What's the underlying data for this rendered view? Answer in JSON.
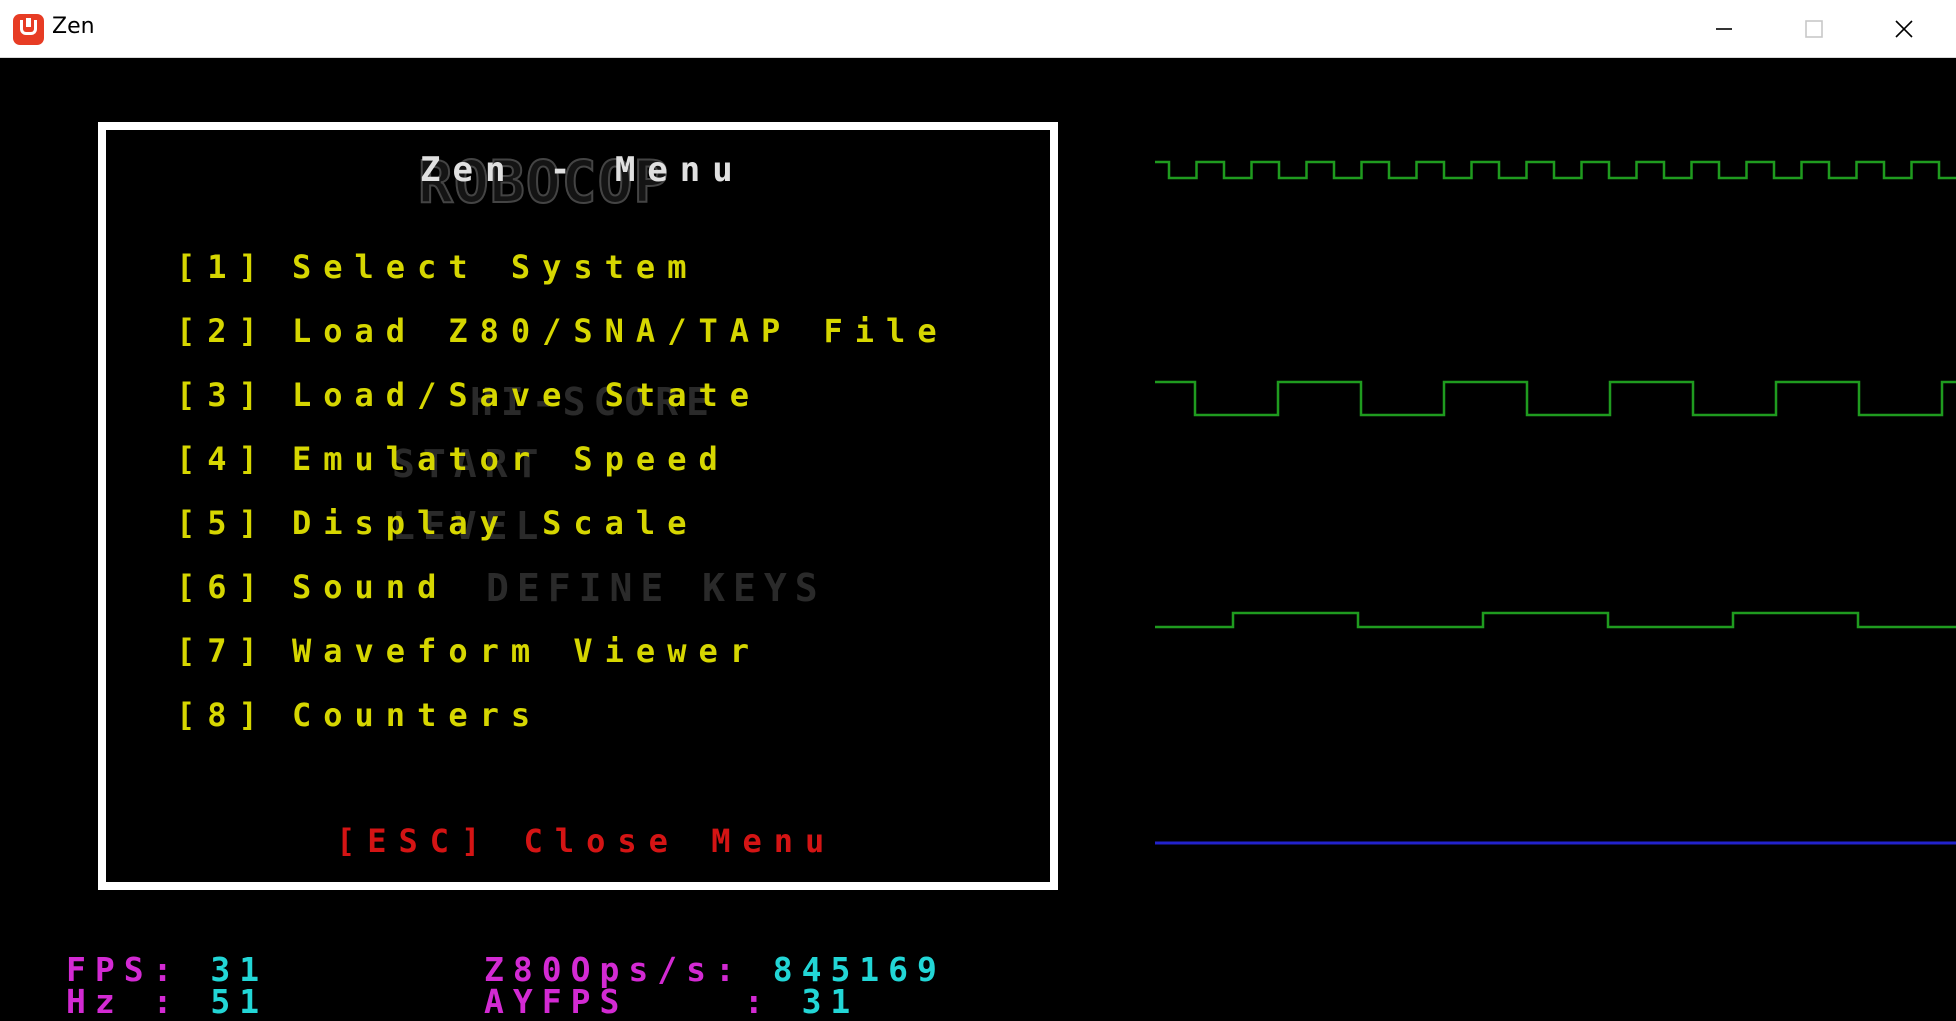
{
  "window": {
    "title": "Zen",
    "minimize_icon": "minimize-icon",
    "maximize_icon": "maximize-icon",
    "close_icon": "close-icon"
  },
  "background": {
    "logo": "ROBOCOP",
    "hidden_texts": [
      "HI-SCORE",
      "START",
      "LEVEL",
      "DEFINE KEYS"
    ]
  },
  "menu": {
    "title": "Zen - Menu",
    "items": [
      {
        "key": "[1]",
        "label": "Select System"
      },
      {
        "key": "[2]",
        "label": "Load Z80/SNA/TAP File"
      },
      {
        "key": "[3]",
        "label": "Load/Save State"
      },
      {
        "key": "[4]",
        "label": "Emulator Speed"
      },
      {
        "key": "[5]",
        "label": "Display Scale"
      },
      {
        "key": "[6]",
        "label": "Sound"
      },
      {
        "key": "[7]",
        "label": "Waveform Viewer"
      },
      {
        "key": "[8]",
        "label": "Counters"
      }
    ],
    "close": {
      "key": "[ESC]",
      "label": "Close Menu"
    }
  },
  "waveforms": {
    "colors": {
      "channel": "#1f9b1f",
      "beeper": "#2222cc"
    }
  },
  "status": {
    "fps_label": "FPS",
    "fps_value": "31",
    "hz_label": "Hz",
    "hz_value": "51",
    "z80_label": "Z80Ops/s",
    "z80_value": "845169",
    "ayfps_label": "AYFPS",
    "ayfps_value": "31"
  },
  "colors": {
    "menu_item": "#d6d600",
    "close": "#d41414",
    "status_label": "#d32ad3",
    "status_value": "#22d6d6"
  }
}
